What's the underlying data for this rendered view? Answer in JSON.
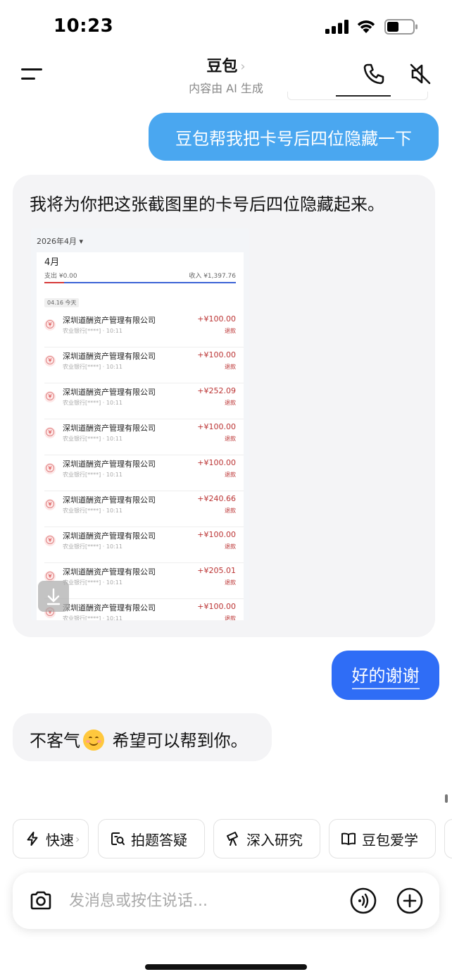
{
  "status_bar": {
    "time": "10:23"
  },
  "header": {
    "title": "豆包",
    "title_chevron": "›",
    "subtitle": "内容由 AI 生成"
  },
  "messages": {
    "user_1": "豆包帮我把卡号后四位隐藏一下",
    "bot_1": "我将为你把这张截图里的卡号后四位隐藏起来。",
    "user_2": "好的谢谢",
    "bot_2_before": "不客气",
    "bot_2_after": " 希望可以帮到你。"
  },
  "embedded_screenshot": {
    "month_select": "2026年4月 ▾",
    "month": "4月",
    "expense": "支出 ¥0.00",
    "income": "收入 ¥1,397.76",
    "date_tag": "04.16  今天",
    "rows": [
      {
        "name": "深圳道酬资产管理有限公司",
        "sub": "农业银行[****] · 10:11",
        "amount": "+¥100.00",
        "type": "退款"
      },
      {
        "name": "深圳道酬资产管理有限公司",
        "sub": "农业银行[****] · 10:11",
        "amount": "+¥100.00",
        "type": "退款"
      },
      {
        "name": "深圳道酬资产管理有限公司",
        "sub": "农业银行[****] · 10:11",
        "amount": "+¥252.09",
        "type": "退款"
      },
      {
        "name": "深圳道酬资产管理有限公司",
        "sub": "农业银行[****] · 10:11",
        "amount": "+¥100.00",
        "type": "退款"
      },
      {
        "name": "深圳道酬资产管理有限公司",
        "sub": "农业银行[****] · 10:11",
        "amount": "+¥100.00",
        "type": "退款"
      },
      {
        "name": "深圳道酬资产管理有限公司",
        "sub": "农业银行[****] · 10:11",
        "amount": "+¥240.66",
        "type": "退款"
      },
      {
        "name": "深圳道酬资产管理有限公司",
        "sub": "农业银行[****] · 10:11",
        "amount": "+¥100.00",
        "type": "退款"
      },
      {
        "name": "深圳道酬资产管理有限公司",
        "sub": "农业银行[****] · 10:11",
        "amount": "+¥205.01",
        "type": "退款"
      },
      {
        "name": "深圳道酬资产管理有限公司",
        "sub": "农业银行[****] · 10:11",
        "amount": "+¥100.00",
        "type": "退款"
      }
    ]
  },
  "chips": {
    "fast": "快速",
    "fast_chevron": "›",
    "photo_qa": "拍题答疑",
    "deep_research": "深入研究",
    "doubao_learn": "豆包爱学"
  },
  "input": {
    "placeholder": "发消息或按住说话..."
  },
  "colors": {
    "user_bubble_1": "#4aa7f0",
    "user_bubble_2": "#2f6df6",
    "bot_bubble": "#f4f4f6",
    "amount_red": "#b33333"
  },
  "icons": [
    "menu-icon",
    "phone-icon",
    "mute-icon",
    "download-icon",
    "lightning-icon",
    "photo-search-icon",
    "telescope-icon",
    "book-icon",
    "camera-icon",
    "voice-icon",
    "plus-icon"
  ]
}
